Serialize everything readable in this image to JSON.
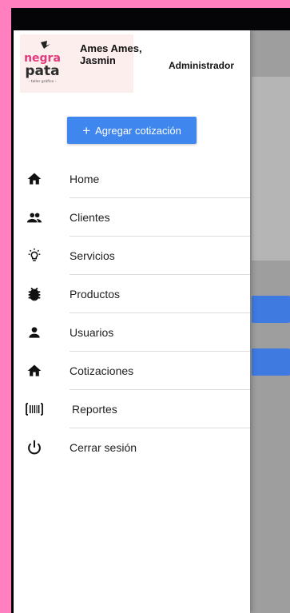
{
  "user": {
    "name": "Ames Ames, Jasmin",
    "role": "Administrador",
    "logo_text_top": "negra",
    "logo_text_bottom": "pata",
    "logo_tagline": "- taller gráfico -"
  },
  "add_button": {
    "plus": "+",
    "label": "Agregar cotización"
  },
  "menu": [
    {
      "label": "Home",
      "icon": "home-icon"
    },
    {
      "label": "Clientes",
      "icon": "people-icon"
    },
    {
      "label": "Servicios",
      "icon": "lightbulb-icon"
    },
    {
      "label": "Productos",
      "icon": "bug-icon"
    },
    {
      "label": "Usuarios",
      "icon": "person-icon"
    },
    {
      "label": "Cotizaciones",
      "icon": "home-icon"
    },
    {
      "label": "Reportes",
      "icon": "barcode-icon"
    },
    {
      "label": "Cerrar sesión",
      "icon": "power-icon"
    }
  ],
  "colors": {
    "primary": "#3f86ee",
    "page_background": "#ff7fbf",
    "overlay": "#9e9e9e"
  }
}
